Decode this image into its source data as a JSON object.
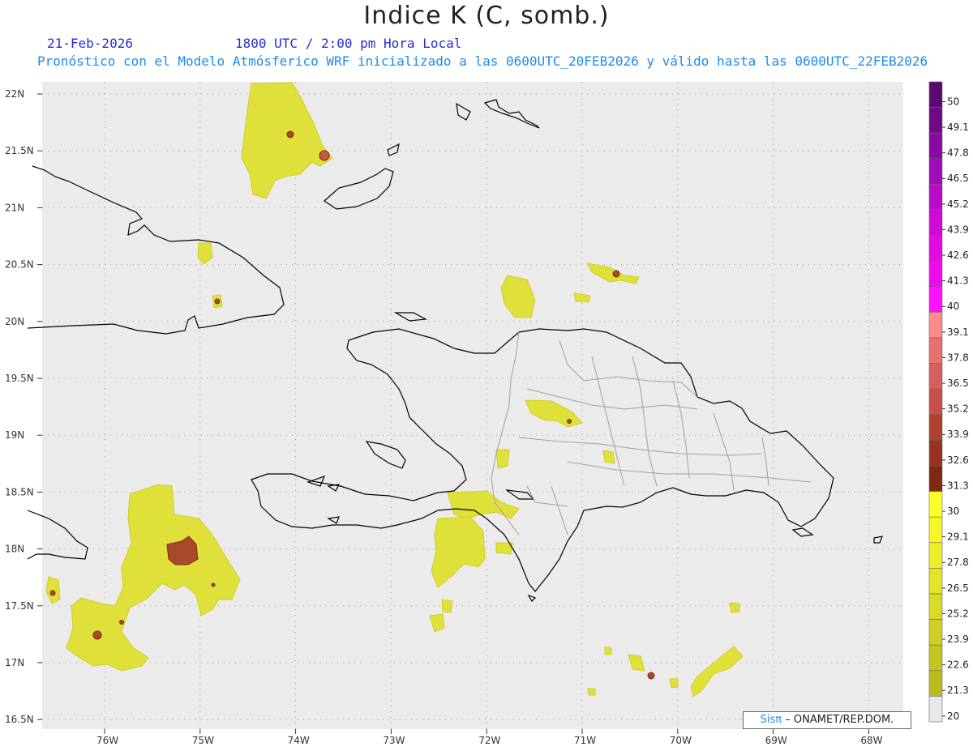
{
  "header": {
    "title": "Indice K (C, somb.)",
    "date": "21-Feb-2026",
    "time": "1800 UTC / 2:00 pm Hora Local",
    "description": "Pronóstico con el Modelo Atmósferico WRF inicializado a las 0600UTC_20FEB2026 y válido hasta las  0600UTC_22FEB2026"
  },
  "map": {
    "variable": "K index",
    "units": "C",
    "lat_labels": [
      "22N",
      "21.5N",
      "21N",
      "20.5N",
      "20N",
      "19.5N",
      "19N",
      "18.5N",
      "18N",
      "17.5N",
      "17N",
      "16.5N"
    ],
    "lon_labels": [
      "76W",
      "75W",
      "74W",
      "73W",
      "72W",
      "71W",
      "70W",
      "69W",
      "68W"
    ],
    "background_color": "#ebebeb",
    "coastline_color": "#000000",
    "province_border_color": "#a0a0a0",
    "grid": "dotted"
  },
  "colorbar": {
    "levels": [
      "50",
      "49.1",
      "47.8",
      "46.5",
      "45.2",
      "43.9",
      "42.6",
      "41.3",
      "40",
      "39.1",
      "37.8",
      "36.5",
      "35.2",
      "33.9",
      "32.6",
      "31.3",
      "30",
      "29.1",
      "27.8",
      "26.5",
      "25.2",
      "23.9",
      "22.6",
      "21.3",
      "20"
    ],
    "colors": [
      "#5a0a6e",
      "#6e0a86",
      "#880aa0",
      "#a00ab8",
      "#bb0acc",
      "#d20ad8",
      "#e40ae0",
      "#f00af0",
      "#ff10ff",
      "#ff8a8a",
      "#ea7070",
      "#d66060",
      "#c85048",
      "#b04030",
      "#9a3220",
      "#7e2a10",
      "#ffff2a",
      "#f6f62a",
      "#eeee2a",
      "#e4e42a",
      "#dada28",
      "#cfcf26",
      "#c4c422",
      "#bbbb1e",
      "#e8e8e8"
    ]
  },
  "credit": {
    "brand": "Sisπ",
    "org": "– ONAMET/REP.DOM."
  }
}
